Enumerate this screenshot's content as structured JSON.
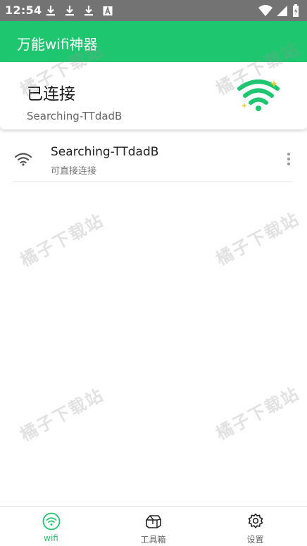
{
  "status_bar": {
    "time": "12:54",
    "icons_left": [
      "download-icon",
      "download-icon",
      "download-icon",
      "keyboard-a-icon"
    ],
    "icons_right": [
      "wifi-signal-icon",
      "cell-signal-icon",
      "battery-icon"
    ]
  },
  "app_bar": {
    "title": "万能wifi神器",
    "background": "#1ec76f"
  },
  "connected": {
    "status": "已连接",
    "ssid": "Searching-TTdadB",
    "accent": "#1ec76f"
  },
  "networks": [
    {
      "ssid": "Searching-TTdadB",
      "description": "可直接连接"
    }
  ],
  "watermark": "橘子下载站",
  "bottom_nav": [
    {
      "label": "wifi",
      "icon": "wifi-icon",
      "active": true
    },
    {
      "label": "工具箱",
      "icon": "toolbox-icon",
      "active": false
    },
    {
      "label": "设置",
      "icon": "settings-gear-icon",
      "active": false
    }
  ]
}
